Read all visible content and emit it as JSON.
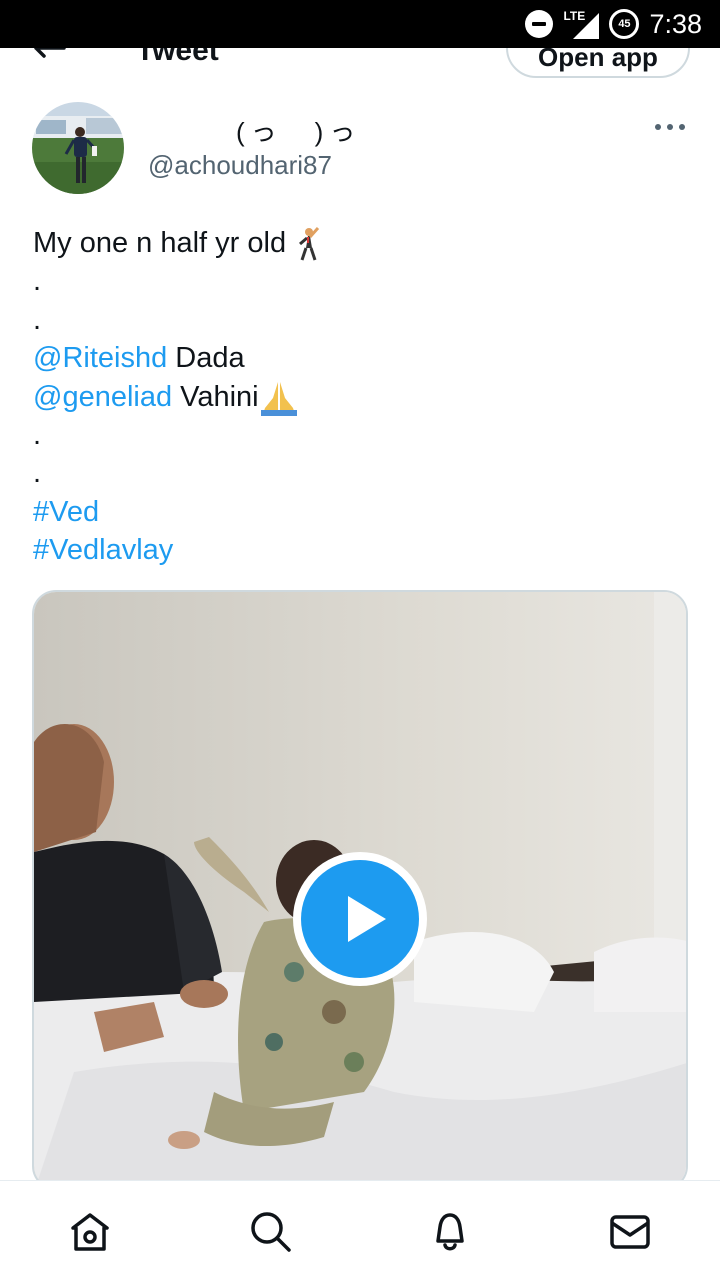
{
  "status_bar": {
    "network": "LTE",
    "battery": "45",
    "time": "7:38"
  },
  "header": {
    "title": "Tweet",
    "open_app_label": "Open app",
    "back_icon": "back-arrow-icon"
  },
  "author": {
    "display_name": "(っ　)っ",
    "handle": "@achoudhari87"
  },
  "tweet": {
    "lines": [
      {
        "text": "My one n half yr old "
      },
      {
        "text": "."
      },
      {
        "text": "."
      },
      {
        "mention": "@Riteishd",
        "text": " Dada"
      },
      {
        "mention": "@geneliad",
        "text": " Vahini"
      },
      {
        "text": "."
      },
      {
        "text": "."
      },
      {
        "hashtag": "#Ved"
      },
      {
        "hashtag": "#Vedlavlay"
      }
    ]
  },
  "media": {
    "type": "video",
    "play_icon": "play-icon"
  },
  "bottom_nav": {
    "items": [
      "home-icon",
      "search-icon",
      "notifications-icon",
      "messages-icon"
    ]
  },
  "colors": {
    "link": "#1d9bf0",
    "text": "#0f1419",
    "secondary": "#536471",
    "border": "#cfd9de"
  }
}
